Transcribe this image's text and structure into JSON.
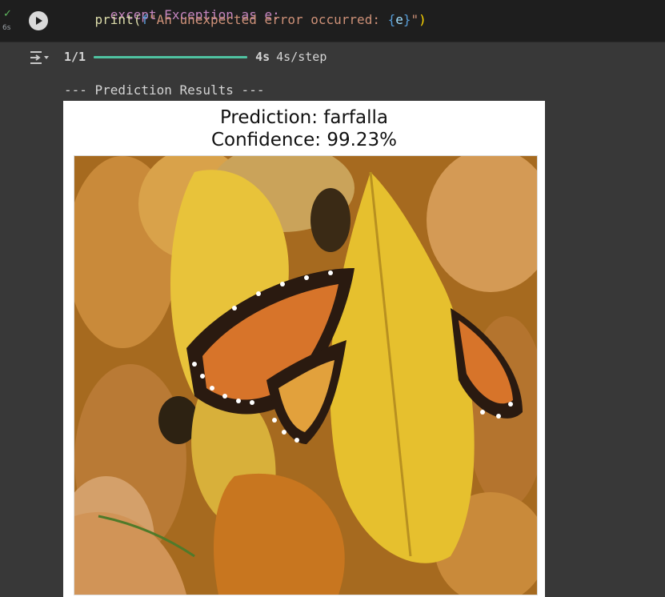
{
  "cell": {
    "status_icon": "check-icon",
    "exec_time": "6s",
    "code_line1": "except Exception as e:",
    "code_line2_prefix": "    print(",
    "code_line2_fstring_prefix": "f",
    "code_line2_string_start": "\"An unexpected error occurred: ",
    "code_line2_var": "e",
    "code_line2_string_end": "\"",
    "code_line2_close": ")"
  },
  "output": {
    "progress_step": "1/1",
    "progress_value": 1.0,
    "total_time": "4s",
    "step_time": "4s/step",
    "results_header": "--- Prediction Results ---",
    "figure": {
      "title_line1": "Prediction: farfalla",
      "title_line2": "Confidence: 99.23%"
    }
  },
  "colors": {
    "notebook_bg": "#383838",
    "cell_bg": "#1e1e1e",
    "progress_bar": "#4fc3a1",
    "check": "#5fb85f"
  }
}
